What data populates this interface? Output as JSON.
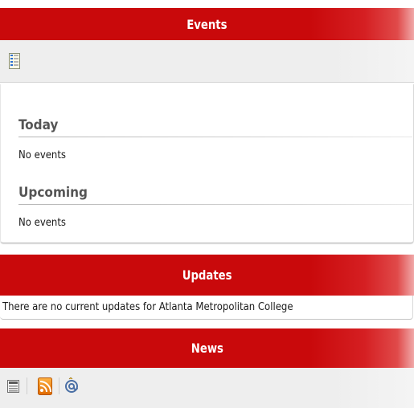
{
  "events": {
    "header": "Events",
    "toolbar_icons": [
      "list-view-icon"
    ],
    "today_label": "Today",
    "today_empty": "No events",
    "upcoming_label": "Upcoming",
    "upcoming_empty": "No events"
  },
  "updates": {
    "header": "Updates",
    "message": "There are no current updates for Atlanta Metropolitan College"
  },
  "news": {
    "header": "News",
    "toolbar_icons": [
      "news-list-icon",
      "rss-feed-icon",
      "email-subscribe-icon"
    ]
  },
  "colors": {
    "header_red": "#c9090b",
    "toolbar_gray": "#eeeeee",
    "rss_orange": "#f28a1c"
  }
}
